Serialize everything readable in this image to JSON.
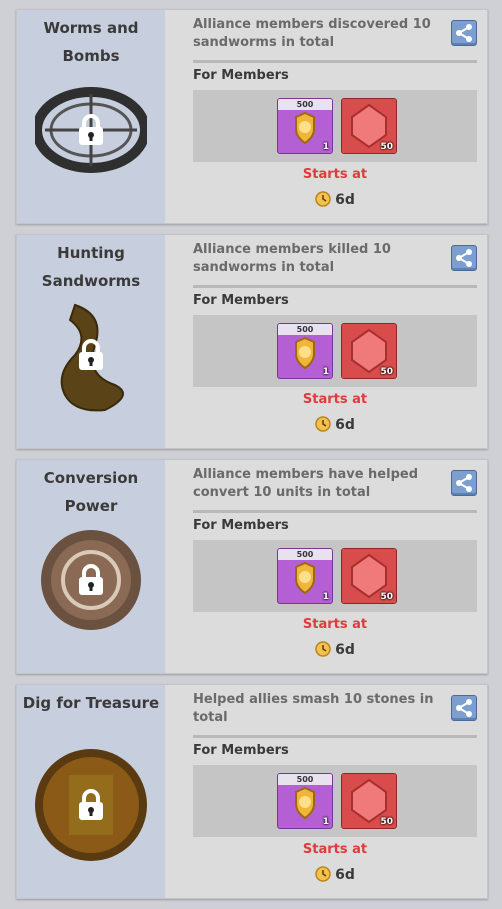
{
  "events": [
    {
      "title": "Worms and Bombs",
      "description": "Alliance members discovered 10 sandworms in total",
      "for_members": "For Members",
      "rewards": [
        {
          "top": "500",
          "qty": "1"
        },
        {
          "qty": "50"
        }
      ],
      "starts_at": "Starts at",
      "time": "6d"
    },
    {
      "title": "Hunting Sandworms",
      "description": "Alliance members killed 10 sandworms in total",
      "for_members": "For Members",
      "rewards": [
        {
          "top": "500",
          "qty": "1"
        },
        {
          "qty": "50"
        }
      ],
      "starts_at": "Starts at",
      "time": "6d"
    },
    {
      "title": "Conversion Power",
      "description": "Alliance members have helped convert 10 units in total",
      "for_members": "For Members",
      "rewards": [
        {
          "top": "500",
          "qty": "1"
        },
        {
          "qty": "50"
        }
      ],
      "starts_at": "Starts at",
      "time": "6d"
    },
    {
      "title": "Dig for Treasure",
      "description": "Helped allies smash 10 stones in total",
      "for_members": "For Members",
      "rewards": [
        {
          "top": "500",
          "qty": "1"
        },
        {
          "qty": "50"
        }
      ],
      "starts_at": "Starts at",
      "time": "6d"
    }
  ],
  "icons": {
    "share": "share-icon",
    "lock": "lock-icon",
    "clock": "clock-icon",
    "badge": "badge-icon",
    "gem": "gem-icon"
  },
  "colors": {
    "starts_at": "#e03a3a",
    "badge_bg": "#b55fd4",
    "gem_bg": "#d84c4c",
    "left_panel": "#c7cedd"
  }
}
